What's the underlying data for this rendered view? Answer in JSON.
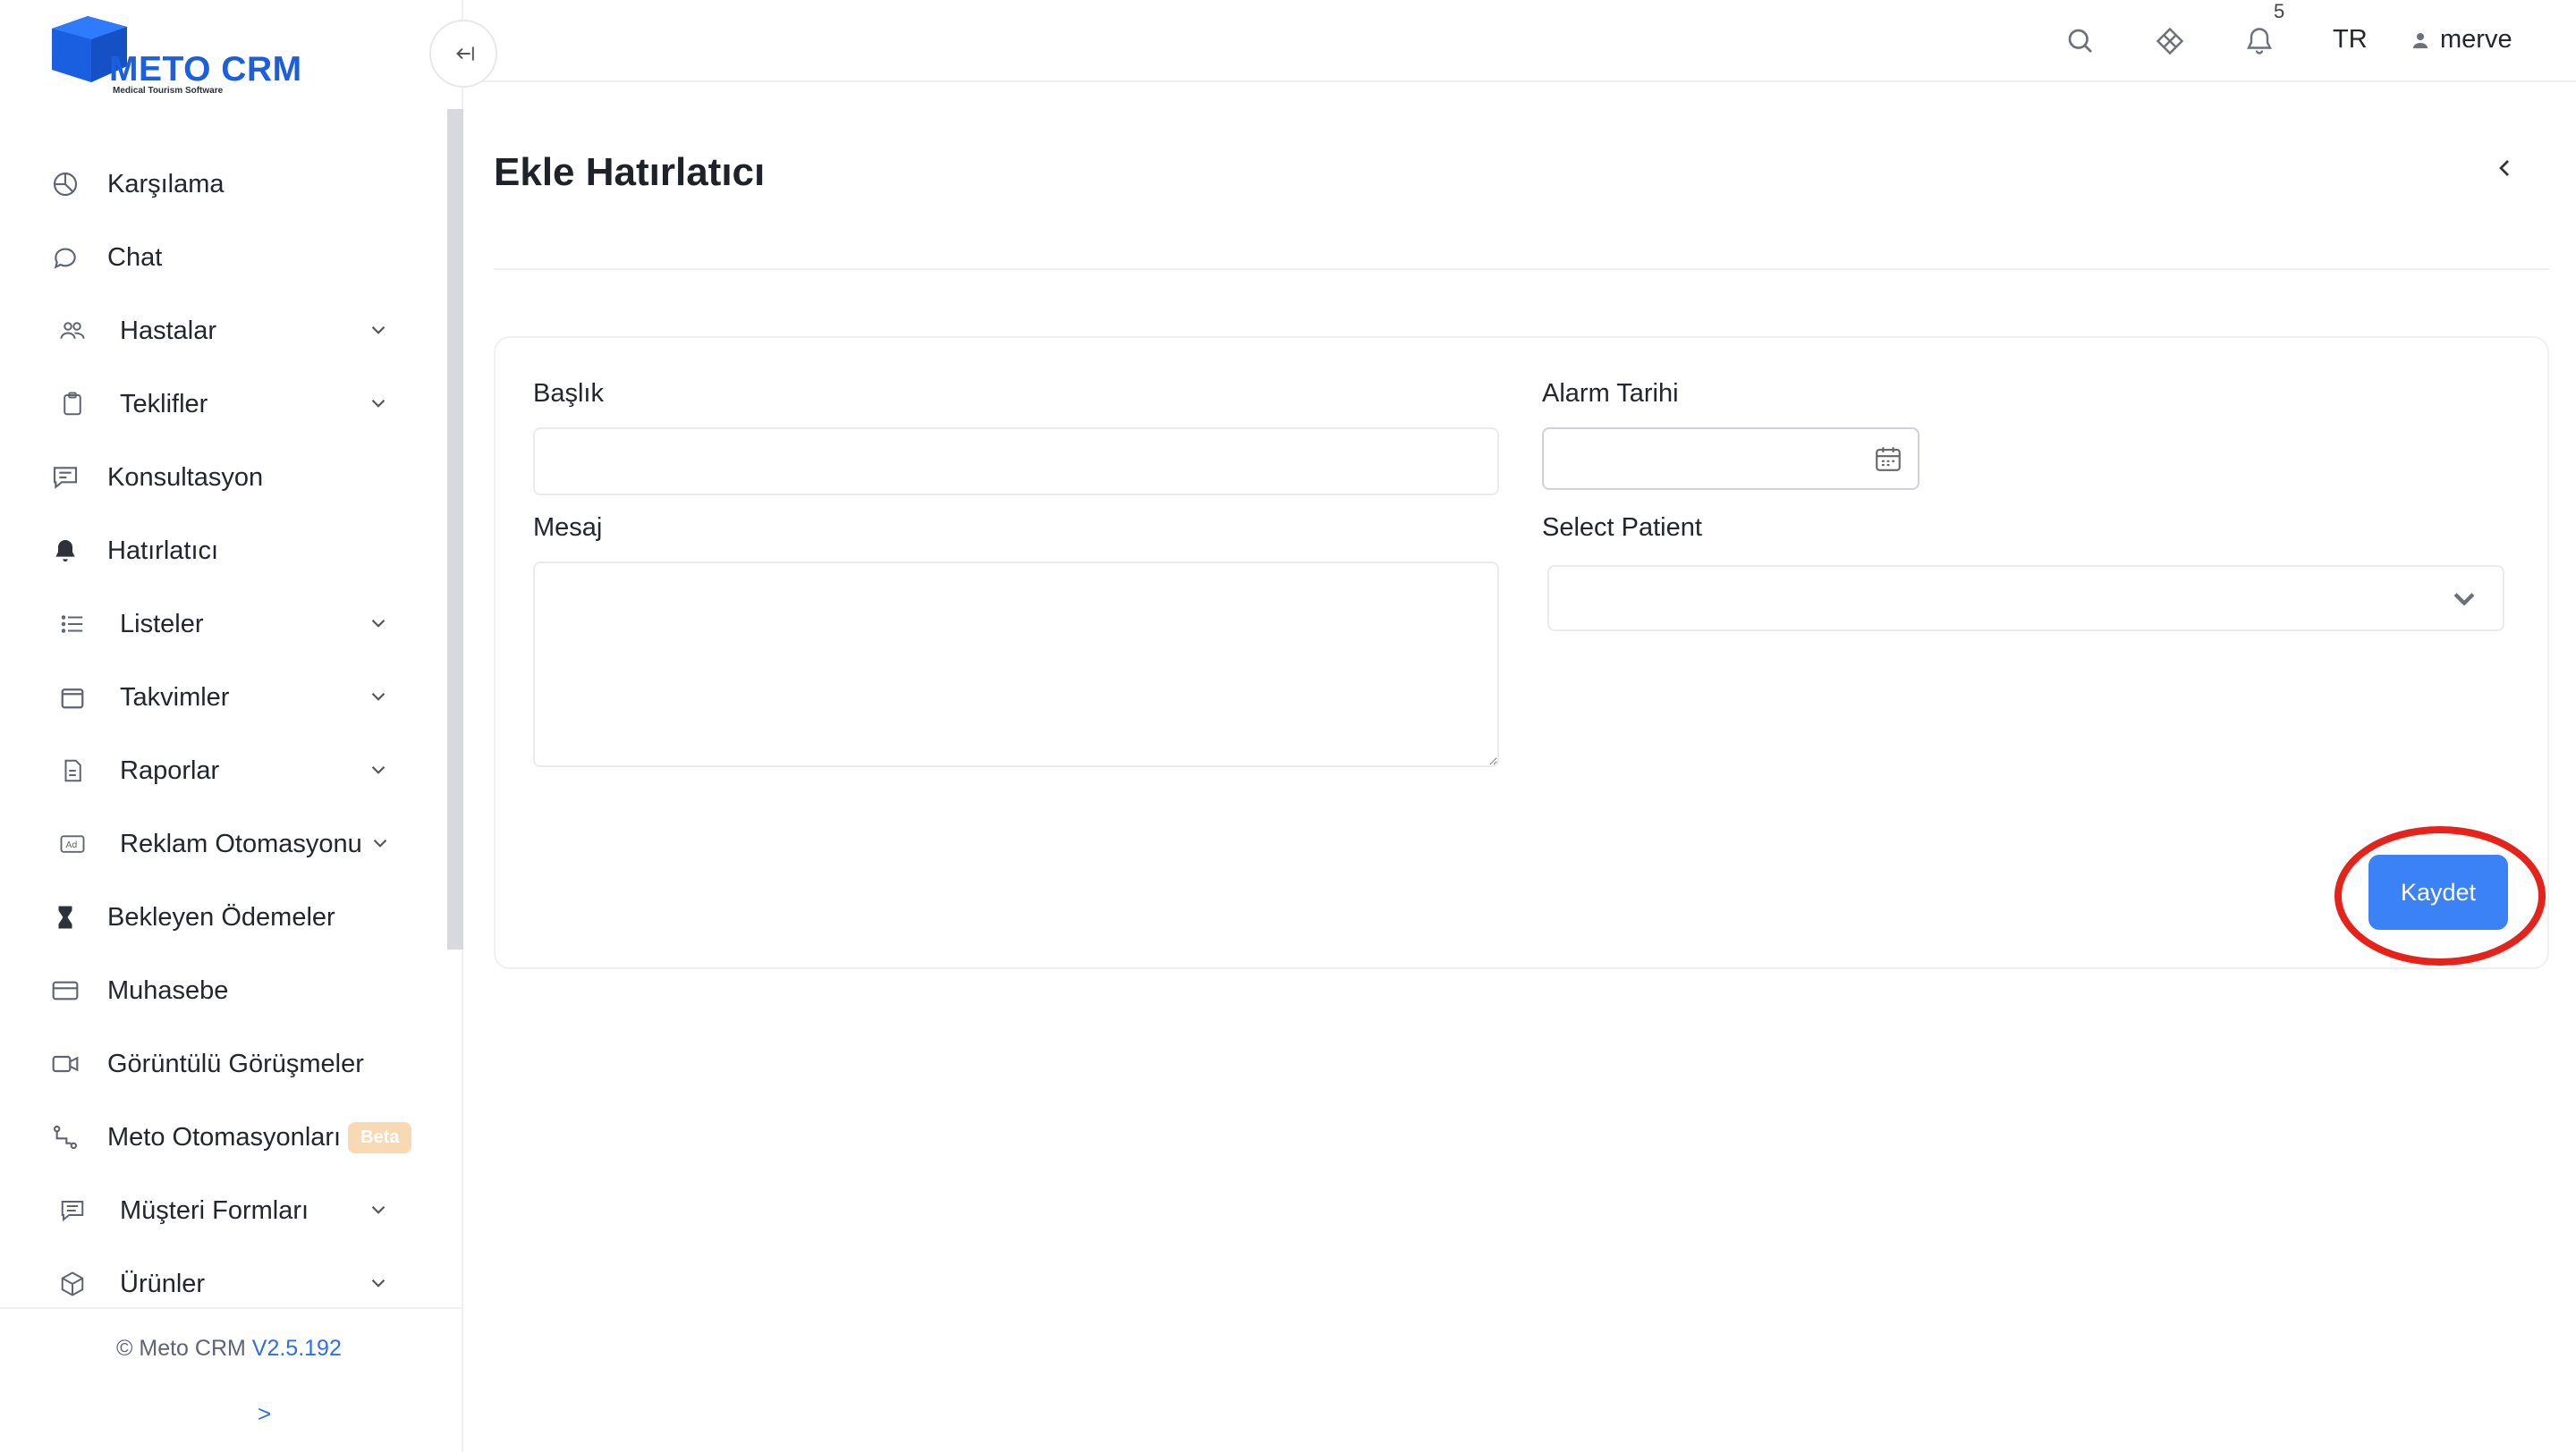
{
  "app": {
    "brand": "METO CRM",
    "tagline": "Medical Tourism Software"
  },
  "sidebar": {
    "items": [
      {
        "label": "Karşılama",
        "icon": "pie-chart-icon",
        "has_submenu": false
      },
      {
        "label": "Chat",
        "icon": "chat-bubble-icon",
        "has_submenu": false
      },
      {
        "label": "Hastalar",
        "icon": "users-icon",
        "has_submenu": true
      },
      {
        "label": "Teklifler",
        "icon": "clipboard-icon",
        "has_submenu": true
      },
      {
        "label": "Konsultasyon",
        "icon": "message-square-icon",
        "has_submenu": false
      },
      {
        "label": "Hatırlatıcı",
        "icon": "bell-icon",
        "has_submenu": false,
        "active": true
      },
      {
        "label": "Listeler",
        "icon": "list-icon",
        "has_submenu": true
      },
      {
        "label": "Takvimler",
        "icon": "calendar-icon",
        "has_submenu": true
      },
      {
        "label": "Raporlar",
        "icon": "document-icon",
        "has_submenu": true
      },
      {
        "label": "Reklam Otomasyonu",
        "icon": "ad-icon",
        "has_submenu": true
      },
      {
        "label": "Bekleyen Ödemeler",
        "icon": "hourglass-icon",
        "has_submenu": false
      },
      {
        "label": "Muhasebe",
        "icon": "credit-card-icon",
        "has_submenu": false
      },
      {
        "label": "Görüntülü Görüşmeler",
        "icon": "video-icon",
        "has_submenu": false
      },
      {
        "label": "Meto Otomasyonları",
        "icon": "workflow-icon",
        "has_submenu": false,
        "badge": "Beta"
      },
      {
        "label": "Müşteri Formları",
        "icon": "form-icon",
        "has_submenu": true
      },
      {
        "label": "Ürünler",
        "icon": "box-icon",
        "has_submenu": true
      }
    ],
    "footer": {
      "copyright": "© Meto CRM",
      "version": "V2.5.192",
      "expand_symbol": ">"
    }
  },
  "topbar": {
    "notification_count": "5",
    "language": "TR",
    "username": "merve"
  },
  "page": {
    "title": "Ekle Hatırlatıcı"
  },
  "form": {
    "title_label": "Başlık",
    "title_value": "",
    "message_label": "Mesaj",
    "message_value": "",
    "alarm_label": "Alarm Tarihi",
    "alarm_value": "",
    "patient_label": "Select Patient",
    "patient_value": "",
    "save_label": "Kaydet"
  },
  "colors": {
    "brand": "#1a5fe0",
    "primary_button": "#3b82f6",
    "highlight": "#e5231b",
    "beta_badge": "#f8d9b4"
  }
}
